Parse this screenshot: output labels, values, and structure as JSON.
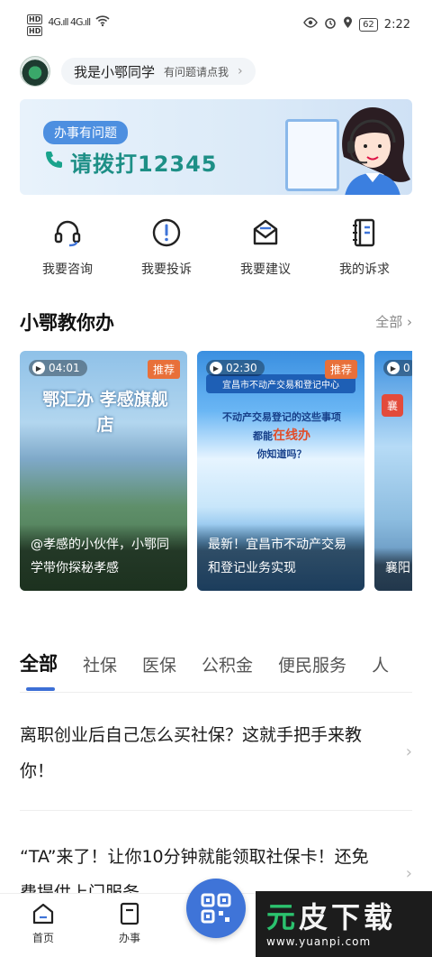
{
  "status_bar": {
    "hd1": "HD",
    "hd2": "HD",
    "signal": "4G.ıll 4G.ıll",
    "battery": "62",
    "time": "2:22"
  },
  "assistant": {
    "name": "我是小鄂同学",
    "hint": "有问题请点我"
  },
  "banner": {
    "tag": "办事有问题",
    "call_text": "请拨打12345"
  },
  "actions": [
    {
      "label": "我要咨询",
      "icon": "headset-icon"
    },
    {
      "label": "我要投诉",
      "icon": "alert-circle-icon"
    },
    {
      "label": "我要建议",
      "icon": "mail-icon"
    },
    {
      "label": "我的诉求",
      "icon": "notebook-icon"
    }
  ],
  "section": {
    "title": "小鄂教你办",
    "more": "全部"
  },
  "cards": [
    {
      "duration": "04:01",
      "badge": "推荐",
      "image_title": "鄂汇办 孝感旗舰店",
      "caption": "@孝感的小伙伴，小鄂同学带你探秘孝感"
    },
    {
      "duration": "02:30",
      "badge": "推荐",
      "image_top": "宜昌市不动产交易和登记中心",
      "image_line1": "不动产交易登记的这些事项",
      "image_line2a": "都能",
      "image_line2b": "在线办",
      "image_line3": "你知道吗？",
      "caption": "最新！宜昌市不动产交易和登记业务实现"
    },
    {
      "duration": "0",
      "badge": "襄",
      "caption": "襄阳 住房"
    }
  ],
  "tabs": [
    "全部",
    "社保",
    "医保",
    "公积金",
    "便民服务",
    "人"
  ],
  "articles": [
    {
      "title": "离职创业后自己怎么买社保？这就手把手来教你！"
    },
    {
      "title": "“TA”来了！让你10分钟就能领取社保卡！还免费提供上门服务"
    }
  ],
  "bottom_nav": {
    "home": "首页",
    "service": "办事"
  },
  "watermark": {
    "brand_a": "元",
    "brand_b": "皮下载",
    "url": "www.yuanpi.com"
  },
  "colors": {
    "accent": "#3f74d8",
    "badge": "#e8703a",
    "phone": "#1d8f86"
  }
}
